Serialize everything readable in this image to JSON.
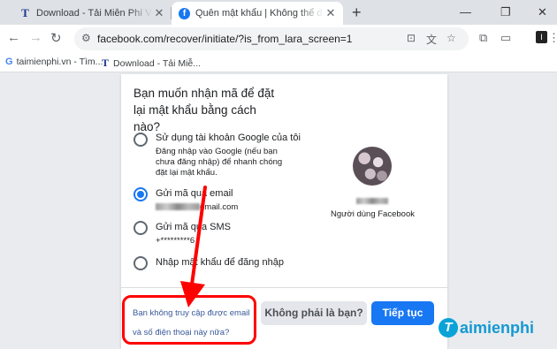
{
  "browser": {
    "tabs": [
      {
        "favicon": "T",
        "title": "Download - Tải Miễn Phí VN - P",
        "close": "✕"
      },
      {
        "favicon": "f",
        "title": "Quên mật khẩu | Không thể đăng",
        "close": "✕"
      }
    ],
    "new_tab": "+",
    "window_controls": {
      "minimize": "—",
      "restore": "❐",
      "close": "✕"
    },
    "url": "facebook.com/recover/initiate/?is_from_lara_screen=1",
    "profile_letter": "I",
    "bookmarks": [
      {
        "favicon": "G",
        "label": "taimienphi.vn - Tìm..."
      },
      {
        "favicon": "T",
        "label": "Download - Tải Miễ..."
      }
    ]
  },
  "recover": {
    "question": "Bạn muốn nhận mã để đặt lại mật khẩu bằng cách nào?",
    "options": [
      {
        "label": "Sử dụng tài khoản Google của tôi",
        "sub": "Đăng nhập vào Google (nếu bạn chưa đăng nhập) để nhanh chóng đặt lại mật khẩu.",
        "checked": false
      },
      {
        "label": "Gửi mã qua email",
        "sub": "gmail.com",
        "checked": true
      },
      {
        "label": "Gửi mã qua SMS",
        "sub": "+*********6",
        "checked": false
      },
      {
        "label": "Nhập mật khẩu để đăng nhập",
        "sub": "",
        "checked": false
      }
    ],
    "profile_caption": "Người dùng Facebook",
    "no_access_link_line1": "Bạn không truy cập được email",
    "no_access_link_line2": "và số điện thoại này nữa?",
    "not_you_button": "Không phải là bạn?",
    "continue_button": "Tiếp tục"
  },
  "watermark": {
    "mark": "T",
    "text": "aimienphi"
  },
  "colors": {
    "facebook_blue": "#1877f2",
    "highlight_red": "#ff0000"
  }
}
